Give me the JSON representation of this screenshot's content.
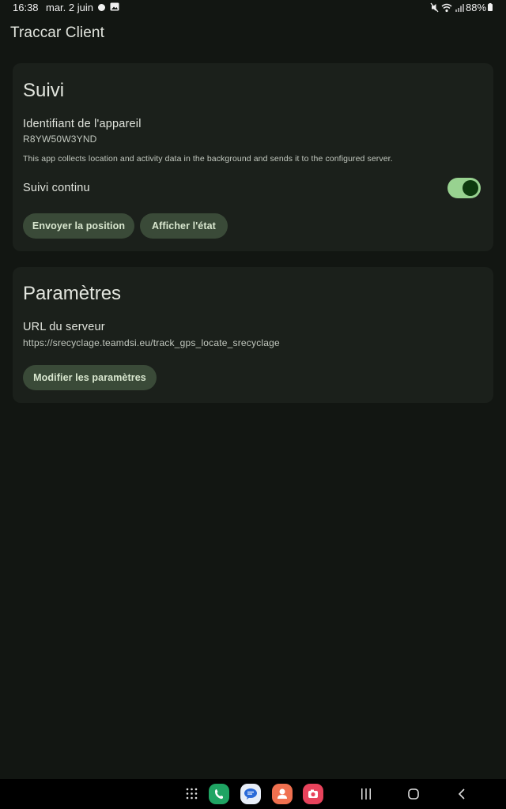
{
  "status_bar": {
    "time": "16:38",
    "date": "mar. 2 juin",
    "battery": "88%"
  },
  "app": {
    "title": "Traccar Client"
  },
  "suivi": {
    "title": "Suivi",
    "device_id_label": "Identifiant de l'appareil",
    "device_id_value": "R8YW50W3YND",
    "description": "This app collects location and activity data in the background and sends it to the configured server.",
    "continuous_label": "Suivi continu",
    "continuous_enabled": true,
    "send_position_button": "Envoyer la position",
    "show_status_button": "Afficher l'état"
  },
  "parametres": {
    "title": "Paramètres",
    "server_url_label": "URL du serveur",
    "server_url_value": "https://srecyclage.teamdsi.eu/track_gps_locate_srecyclage",
    "edit_button": "Modifier les paramètres"
  },
  "dock": {
    "apps": [
      {
        "name": "phone",
        "color": "#1fa463"
      },
      {
        "name": "messages",
        "color": "#e8eef8"
      },
      {
        "name": "contacts",
        "color": "#f0704f"
      },
      {
        "name": "camera",
        "color": "#e8435c"
      }
    ]
  },
  "colors": {
    "background": "#121612",
    "card": "#1b201b",
    "button": "#3a4a38",
    "switch_track": "#98d290",
    "switch_thumb": "#0d3a0e"
  }
}
